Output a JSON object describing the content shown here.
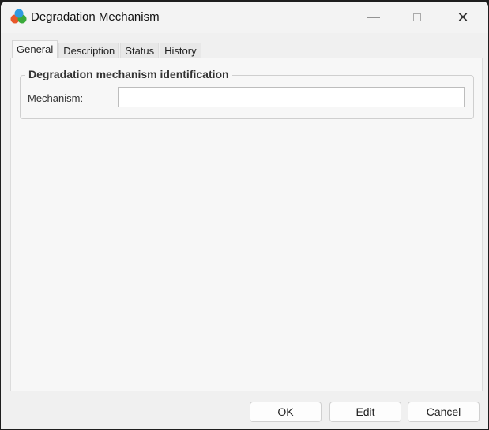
{
  "window": {
    "title": "Degradation Mechanism",
    "icon": "app-molecule-icon",
    "controls": [
      "minimize-icon",
      "maximize-icon",
      "close-icon"
    ]
  },
  "tabs": [
    {
      "label": "General",
      "active": true
    },
    {
      "label": "Description"
    },
    {
      "label": "Status"
    },
    {
      "label": "History"
    }
  ],
  "group": {
    "title": "Degradation mechanism identification",
    "mechanism_label": "Mechanism:",
    "mechanism_value": ""
  },
  "buttons": {
    "ok": "OK",
    "edit": "Edit",
    "cancel": "Cancel"
  }
}
